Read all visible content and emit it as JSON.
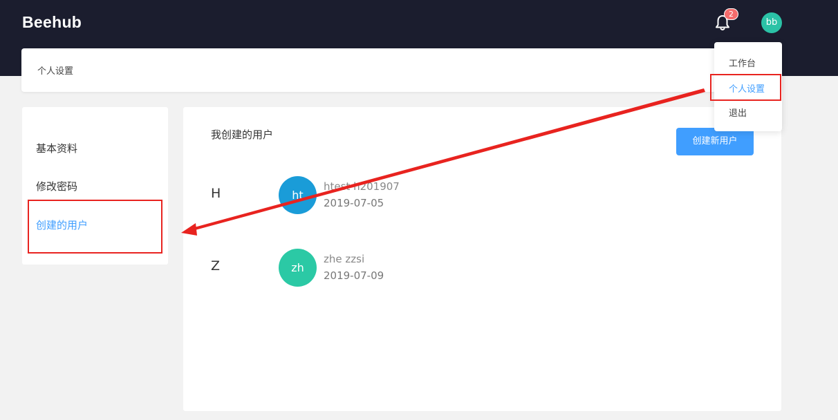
{
  "app": {
    "logo": "Beehub"
  },
  "header": {
    "notification_count": "2",
    "avatar_initials": "bb"
  },
  "user_menu": {
    "items": [
      {
        "label": "工作台"
      },
      {
        "label": "个人设置",
        "active": true
      },
      {
        "label": "退出"
      }
    ]
  },
  "breadcrumb": {
    "title": "个人设置"
  },
  "sidebar": {
    "items": [
      {
        "label": "基本资料"
      },
      {
        "label": "修改密码"
      },
      {
        "label": "创建的用户",
        "active": true
      }
    ]
  },
  "main": {
    "section_title": "我创建的用户",
    "create_button": "创建新用户",
    "groups": [
      {
        "letter": "H",
        "users": [
          {
            "initials": "ht",
            "name": "htest  h201907",
            "date": "2019-07-05",
            "color": "#1a9cd8"
          }
        ]
      },
      {
        "letter": "Z",
        "users": [
          {
            "initials": "zh",
            "name": "zhe  zzsi",
            "date": "2019-07-09",
            "color": "#2bc9a5"
          }
        ]
      }
    ]
  },
  "colors": {
    "topbar": "#1b1d2e",
    "accent": "#409eff",
    "annotation_red": "#e8231f",
    "badge": "#f56c6c",
    "avatar_top": "#2bc2a6"
  }
}
